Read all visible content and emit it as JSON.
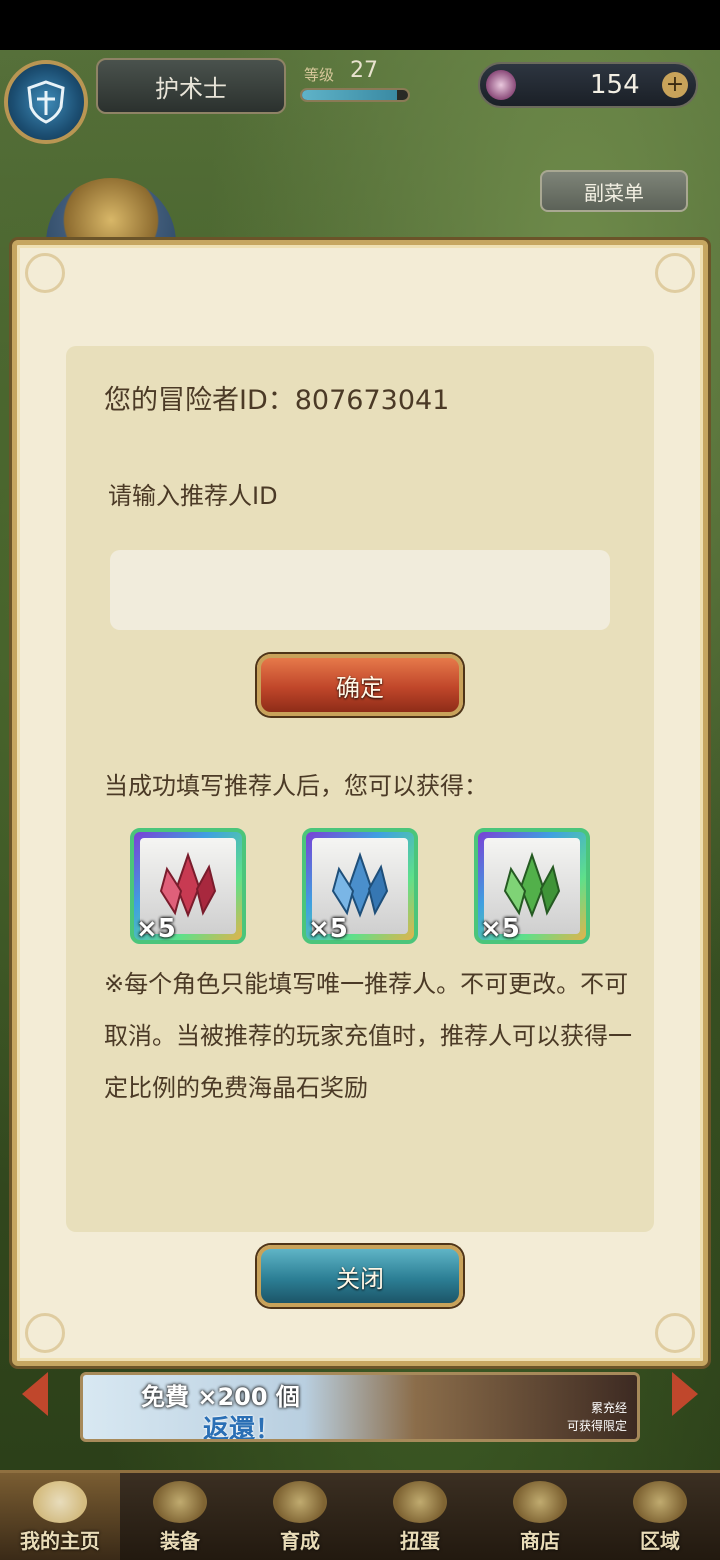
{
  "header": {
    "class_name": "护术士",
    "level_label": "等级",
    "level_value": "27",
    "gem_count": "154",
    "submenu_label": "副菜单"
  },
  "dialog": {
    "adventurer_id_text": "您的冒险者ID：807673041",
    "referrer_prompt": "请输入推荐人ID",
    "referrer_input_value": "",
    "confirm_label": "确定",
    "reward_title": "当成功填写推荐人后，您可以获得：",
    "rewards": [
      {
        "icon": "red-crystal-icon",
        "qty": "×5",
        "color": "#c83a52"
      },
      {
        "icon": "blue-crystal-icon",
        "qty": "×5",
        "color": "#4a8fcc"
      },
      {
        "icon": "green-crystal-icon",
        "qty": "×5",
        "color": "#52b04a"
      }
    ],
    "note": "※每个角色只能填写唯一推荐人。不可更改。不可取消。当被推荐的玩家充值时，推荐人可以获得一定比例的免费海晶石奖励",
    "close_label": "关闭"
  },
  "banner": {
    "line1": "免費 ×200 個",
    "line2": "返還！",
    "side_text": "累充经\n可获得限定"
  },
  "nav": {
    "tabs": [
      {
        "label": "我的主页",
        "active": true
      },
      {
        "label": "装备",
        "active": false
      },
      {
        "label": "育成",
        "active": false
      },
      {
        "label": "扭蛋",
        "active": false
      },
      {
        "label": "商店",
        "active": false
      },
      {
        "label": "区域",
        "active": false
      }
    ]
  },
  "colors": {
    "ok_button": "#c0462a",
    "close_button": "#2c7f95",
    "dialog_bg": "#f3ecd6",
    "text": "#4b3a26"
  }
}
